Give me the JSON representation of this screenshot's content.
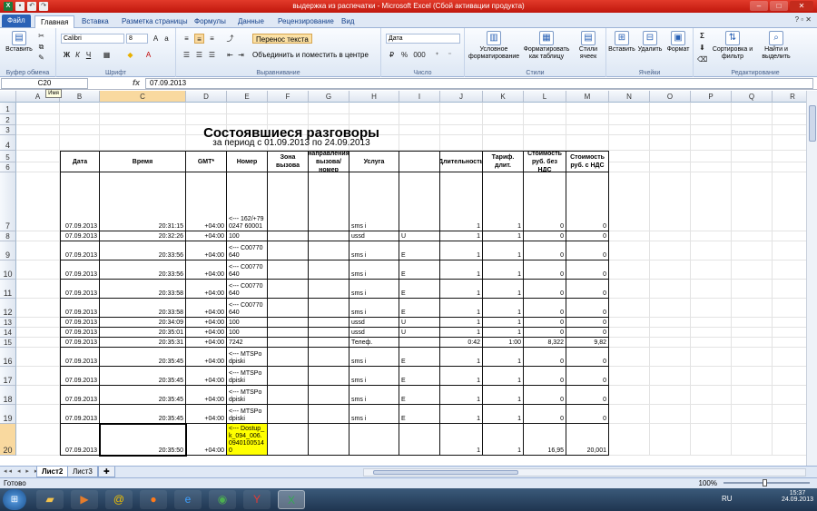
{
  "window": {
    "title": "выдержка из распечатки  -  Microsoft Excel (Сбой активации продукта)"
  },
  "tabs": [
    "Файл",
    "Главная",
    "Вставка",
    "Разметка страницы",
    "Формулы",
    "Данные",
    "Рецензирование",
    "Вид"
  ],
  "ribbon": {
    "paste": "Вставить",
    "clipboard_label": "Буфер обмена",
    "font_name": "Calibri",
    "font_size": "8",
    "font_label": "Шрифт",
    "wrap_text": "Перенос текста",
    "merge_center": "Объединить и поместить в центре",
    "alignment_label": "Выравнивание",
    "number_format": "Дата",
    "number_label": "Число",
    "conditional_formatting": "Условное форматирование",
    "format_as_table": "Форматировать как таблицу",
    "cell_styles": "Стили ячеек",
    "styles_label": "Стили",
    "insert": "Вставить",
    "delete": "Удалить",
    "format": "Формат",
    "cells_label": "Ячейки",
    "sort_filter": "Сортировка и фильтр",
    "find_select": "Найти и выделить",
    "editing_label": "Редактирование",
    "bold": "Ж",
    "italic": "К",
    "underline": "Ч",
    "percent": "%",
    "thousands": "000",
    "sigma": "Σ"
  },
  "formula_bar": {
    "name_box": "C20",
    "fx": "fx",
    "value": "07.09.2013",
    "tooltip": "Имя"
  },
  "columns": [
    "A",
    "B",
    "C",
    "D",
    "E",
    "F",
    "G",
    "H",
    "I",
    "J",
    "K",
    "L",
    "M",
    "N",
    "O",
    "P",
    "Q",
    "R"
  ],
  "rows": [
    "1",
    "2",
    "3",
    "4",
    "5",
    "6",
    "7",
    "8",
    "9",
    "10",
    "11",
    "12",
    "13",
    "14",
    "15",
    "16",
    "17",
    "18",
    "19",
    "20"
  ],
  "report": {
    "title": "Состоявшиеся разговоры",
    "subtitle": "за период с 01.09.2013 по 24.09.2013",
    "headers": {
      "date": "Дата",
      "time": "Время",
      "gmt": "GMT*",
      "number": "Номер",
      "zone_call": "Зона вызова",
      "zone_dir": "Зона направления вызова/номер сессии",
      "service": "Услуга",
      "duration": "Длительность",
      "tariff": "Тариф. длит.",
      "cost_no_vat": "Стоимость руб. без НДС",
      "cost_vat": "Стоимость руб. с НДС"
    },
    "data_rows": [
      {
        "date": "07.09.2013",
        "time": "20:31:15",
        "gmt": "+04:00",
        "number": "<--- 162/+790247 60001",
        "service": "sms i",
        "flag": "",
        "dur": "1",
        "tar": "1",
        "c1": "0",
        "c2": "0"
      },
      {
        "date": "07.09.2013",
        "time": "20:32:26",
        "gmt": "+04:00",
        "number": "100",
        "service": "ussd",
        "flag": "U",
        "dur": "1",
        "tar": "1",
        "c1": "0",
        "c2": "0"
      },
      {
        "date": "07.09.2013",
        "time": "20:33:56",
        "gmt": "+04:00",
        "number": "<--- C00770640",
        "service": "sms i",
        "flag": "E",
        "dur": "1",
        "tar": "1",
        "c1": "0",
        "c2": "0"
      },
      {
        "date": "07.09.2013",
        "time": "20:33:56",
        "gmt": "+04:00",
        "number": "<--- C00770640",
        "service": "sms i",
        "flag": "E",
        "dur": "1",
        "tar": "1",
        "c1": "0",
        "c2": "0"
      },
      {
        "date": "07.09.2013",
        "time": "20:33:58",
        "gmt": "+04:00",
        "number": "<--- C00770640",
        "service": "sms i",
        "flag": "E",
        "dur": "1",
        "tar": "1",
        "c1": "0",
        "c2": "0"
      },
      {
        "date": "07.09.2013",
        "time": "20:33:58",
        "gmt": "+04:00",
        "number": "<--- C00770640",
        "service": "sms i",
        "flag": "E",
        "dur": "1",
        "tar": "1",
        "c1": "0",
        "c2": "0"
      },
      {
        "date": "07.09.2013",
        "time": "20:34:09",
        "gmt": "+04:00",
        "number": "100",
        "service": "ussd",
        "flag": "U",
        "dur": "1",
        "tar": "1",
        "c1": "0",
        "c2": "0"
      },
      {
        "date": "07.09.2013",
        "time": "20:35:01",
        "gmt": "+04:00",
        "number": "100",
        "service": "ussd",
        "flag": "U",
        "dur": "1",
        "tar": "1",
        "c1": "0",
        "c2": "0"
      },
      {
        "date": "07.09.2013",
        "time": "20:35:31",
        "gmt": "+04:00",
        "number": "7242",
        "service": "Телеф.",
        "flag": "",
        "dur": "0:42",
        "tar": "1:00",
        "c1": "8,322",
        "c2": "9,82"
      },
      {
        "date": "07.09.2013",
        "time": "20:35:45",
        "gmt": "+04:00",
        "number": "<--- MTSPodpiski",
        "service": "sms i",
        "flag": "E",
        "dur": "1",
        "tar": "1",
        "c1": "0",
        "c2": "0"
      },
      {
        "date": "07.09.2013",
        "time": "20:35:45",
        "gmt": "+04:00",
        "number": "<--- MTSPodpiski",
        "service": "sms i",
        "flag": "E",
        "dur": "1",
        "tar": "1",
        "c1": "0",
        "c2": "0"
      },
      {
        "date": "07.09.2013",
        "time": "20:35:45",
        "gmt": "+04:00",
        "number": "<--- MTSPodpiski",
        "service": "sms i",
        "flag": "E",
        "dur": "1",
        "tar": "1",
        "c1": "0",
        "c2": "0"
      },
      {
        "date": "07.09.2013",
        "time": "20:35:45",
        "gmt": "+04:00",
        "number": "<--- MTSPodpiski",
        "service": "sms i",
        "flag": "E",
        "dur": "1",
        "tar": "1",
        "c1": "0",
        "c2": "0"
      },
      {
        "date": "07.09.2013",
        "time": "20:35:50",
        "gmt": "+04:00",
        "number": "<--- Dostup_k_094_006.09401005140",
        "service": "",
        "flag": "",
        "dur": "1",
        "tar": "1",
        "c1": "16,95",
        "c2": "20,001"
      }
    ]
  },
  "sheets": [
    "Лист2",
    "Лист3"
  ],
  "status": {
    "ready": "Готово",
    "zoom": "100%"
  },
  "tray": {
    "lang": "RU",
    "time": "15:37",
    "date": "24.09.2013"
  },
  "colors": {
    "selected_fill": "#ffff00",
    "accent": "#2a62b6",
    "title_bar": "#c0170d"
  }
}
